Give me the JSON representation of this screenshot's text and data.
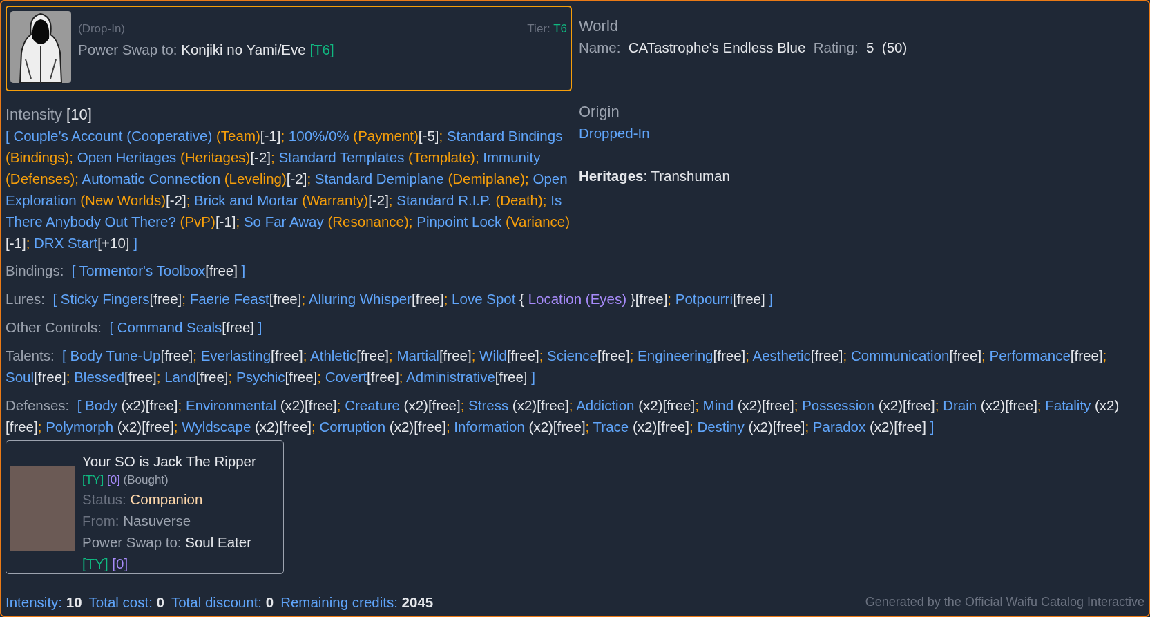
{
  "main_card": {
    "tag": "(Drop-In)",
    "tier_label": "Tier:",
    "tier": "T6",
    "swap_label": "Power Swap to:",
    "swap_name": "Konjiki no Yami/Eve",
    "swap_tier": "[T6]"
  },
  "world": {
    "heading": "World",
    "name_label": "Name:",
    "name": "CATastrophe's Endless Blue",
    "rating_label": "Rating:",
    "rating": "5",
    "rating_total": "(50)"
  },
  "intensity": {
    "heading": "Intensity",
    "value": "[10]",
    "items": [
      {
        "name": "Couple’s Account (Cooperative)",
        "category": "(Team)",
        "cost": "[-1]"
      },
      {
        "name": "100%/0%",
        "category": "(Payment)",
        "cost": "[-5]"
      },
      {
        "name": "Standard Bindings",
        "category": "(Bindings)"
      },
      {
        "name": "Open Heritages",
        "category": "(Heritages)",
        "cost": "[-2]"
      },
      {
        "name": "Standard Templates",
        "category": "(Template)"
      },
      {
        "name": "Immunity",
        "category": "(Defenses)"
      },
      {
        "name": "Automatic Connection",
        "category": "(Leveling)",
        "cost": "[-2]"
      },
      {
        "name": "Standard Demiplane",
        "category": "(Demiplane)"
      },
      {
        "name": "Open Exploration",
        "category": "(New Worlds)",
        "cost": "[-2]"
      },
      {
        "name": "Brick and Mortar",
        "category": "(Warranty)",
        "cost": "[-2]"
      },
      {
        "name": "Standard R.I.P.",
        "category": "(Death)"
      },
      {
        "name": "Is There Anybody Out There?",
        "category": "(PvP)",
        "cost": "[-1]"
      },
      {
        "name": "So Far Away",
        "category": "(Resonance)"
      },
      {
        "name": "Pinpoint Lock",
        "category": "(Variance)",
        "cost": "[-1]"
      },
      {
        "name": "DRX Start",
        "cost": "[+10]"
      }
    ]
  },
  "origin": {
    "heading": "Origin",
    "value": "Dropped-In",
    "heritages": "**Heritages**: Transhuman"
  },
  "symbols": {
    "open": "[",
    "close": "]",
    "separator": ";",
    "detail_open": "{",
    "detail_close": "}"
  },
  "sections": [
    {
      "label": "Bindings:",
      "items": [
        {
          "name": "Tormentor's Toolbox",
          "cost": "[free]"
        }
      ]
    },
    {
      "label": "Lures:",
      "items": [
        {
          "name": "Sticky Fingers",
          "cost": "[free]"
        },
        {
          "name": "Faerie Feast",
          "cost": "[free]"
        },
        {
          "name": "Alluring Whisper",
          "cost": "[free]"
        },
        {
          "name": "Love Spot",
          "detail": "Location (Eyes)",
          "cost": "[free]"
        },
        {
          "name": "Potpourri",
          "cost": "[free]"
        }
      ]
    },
    {
      "label": "Other Controls:",
      "items": [
        {
          "name": "Command Seals",
          "cost": "[free]"
        }
      ]
    },
    {
      "label": "Talents:",
      "items": [
        {
          "name": "Body Tune-Up",
          "cost": "[free]"
        },
        {
          "name": "Everlasting",
          "cost": "[free]"
        },
        {
          "name": "Athletic",
          "cost": "[free]"
        },
        {
          "name": "Martial",
          "cost": "[free]"
        },
        {
          "name": "Wild",
          "cost": "[free]"
        },
        {
          "name": "Science",
          "cost": "[free]"
        },
        {
          "name": "Engineering",
          "cost": "[free]"
        },
        {
          "name": "Aesthetic",
          "cost": "[free]"
        },
        {
          "name": "Communication",
          "cost": "[free]"
        },
        {
          "name": "Performance",
          "cost": "[free]"
        },
        {
          "name": "Soul",
          "cost": "[free]"
        },
        {
          "name": "Blessed",
          "cost": "[free]"
        },
        {
          "name": "Land",
          "cost": "[free]"
        },
        {
          "name": "Psychic",
          "cost": "[free]"
        },
        {
          "name": "Covert",
          "cost": "[free]"
        },
        {
          "name": "Administrative",
          "cost": "[free]"
        }
      ]
    },
    {
      "label": "Defenses:",
      "items": [
        {
          "name": "Body",
          "count": "(x2)",
          "cost": "[free]"
        },
        {
          "name": "Environmental",
          "count": "(x2)",
          "cost": "[free]"
        },
        {
          "name": "Creature",
          "count": "(x2)",
          "cost": "[free]"
        },
        {
          "name": "Stress",
          "count": "(x2)",
          "cost": "[free]"
        },
        {
          "name": "Addiction",
          "count": "(x2)",
          "cost": "[free]"
        },
        {
          "name": "Mind",
          "count": "(x2)",
          "cost": "[free]"
        },
        {
          "name": "Possession",
          "count": "(x2)",
          "cost": "[free]"
        },
        {
          "name": "Drain",
          "count": "(x2)",
          "cost": "[free]"
        },
        {
          "name": "Fatality",
          "count": "(x2)",
          "cost": "[free]"
        },
        {
          "name": "Polymorph",
          "count": "(x2)",
          "cost": "[free]"
        },
        {
          "name": "Wyldscape",
          "count": "(x2)",
          "cost": "[free]"
        },
        {
          "name": "Corruption",
          "count": "(x2)",
          "cost": "[free]"
        },
        {
          "name": "Information",
          "count": "(x2)",
          "cost": "[free]"
        },
        {
          "name": "Trace",
          "count": "(x2)",
          "cost": "[free]"
        },
        {
          "name": "Destiny",
          "count": "(x2)",
          "cost": "[free]"
        },
        {
          "name": "Paradox",
          "count": "(x2)",
          "cost": "[free]"
        }
      ]
    }
  ],
  "companions": [
    {
      "name": "Your SO is Jack The Ripper",
      "tier": "[TY]",
      "cost": "[0]",
      "acquisition": "(Bought)",
      "status_label": "Status:",
      "status": "Companion",
      "from_label": "From:",
      "from": "Nasuverse",
      "swap_label": "Power Swap to:",
      "swap_name": "Soul Eater",
      "swap_tier": "[TY]",
      "swap_cost": "[0]"
    }
  ],
  "totals": [
    {
      "label": "Intensity:",
      "value": "10"
    },
    {
      "label": "Total cost:",
      "value": "0"
    },
    {
      "label": "Total discount:",
      "value": "0"
    },
    {
      "label": "Remaining credits:",
      "value": "2045"
    }
  ],
  "credit": "Generated by the Official Waifu Catalog Interactive"
}
